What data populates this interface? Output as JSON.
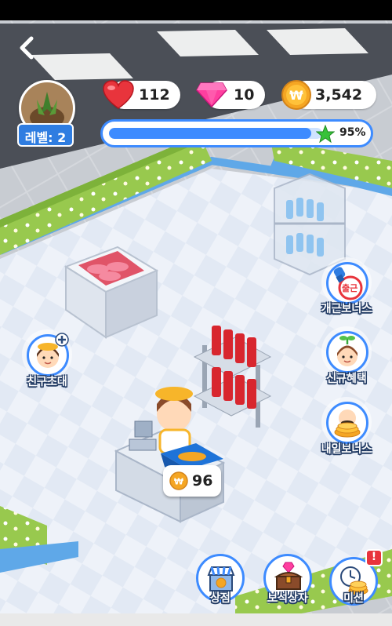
{
  "hud": {
    "level_label": "레벨: 2",
    "hearts": "112",
    "gems": "10",
    "coins": "3,542",
    "progress_fraction": 0.95,
    "progress_text": "95%"
  },
  "side_buttons": {
    "invite_friends": "친구초대",
    "opening_bonus": "개근보너스",
    "opening_bonus_badge": "출근",
    "new_benefits": "신규혜택",
    "tomorrow_bonus": "내일보너스"
  },
  "counter": {
    "coin_amount": "96"
  },
  "bottom_buttons": {
    "shop": "상점",
    "gem_box": "보석상자",
    "mission": "미션",
    "mission_alert": "!"
  },
  "colors": {
    "accent_blue": "#3d8bff",
    "level_badge": "#2f7de1",
    "coin_gold": "#f5a623",
    "heart_red": "#e8343c",
    "gem_pink": "#ff3f9f",
    "star_green": "#37c23a"
  }
}
